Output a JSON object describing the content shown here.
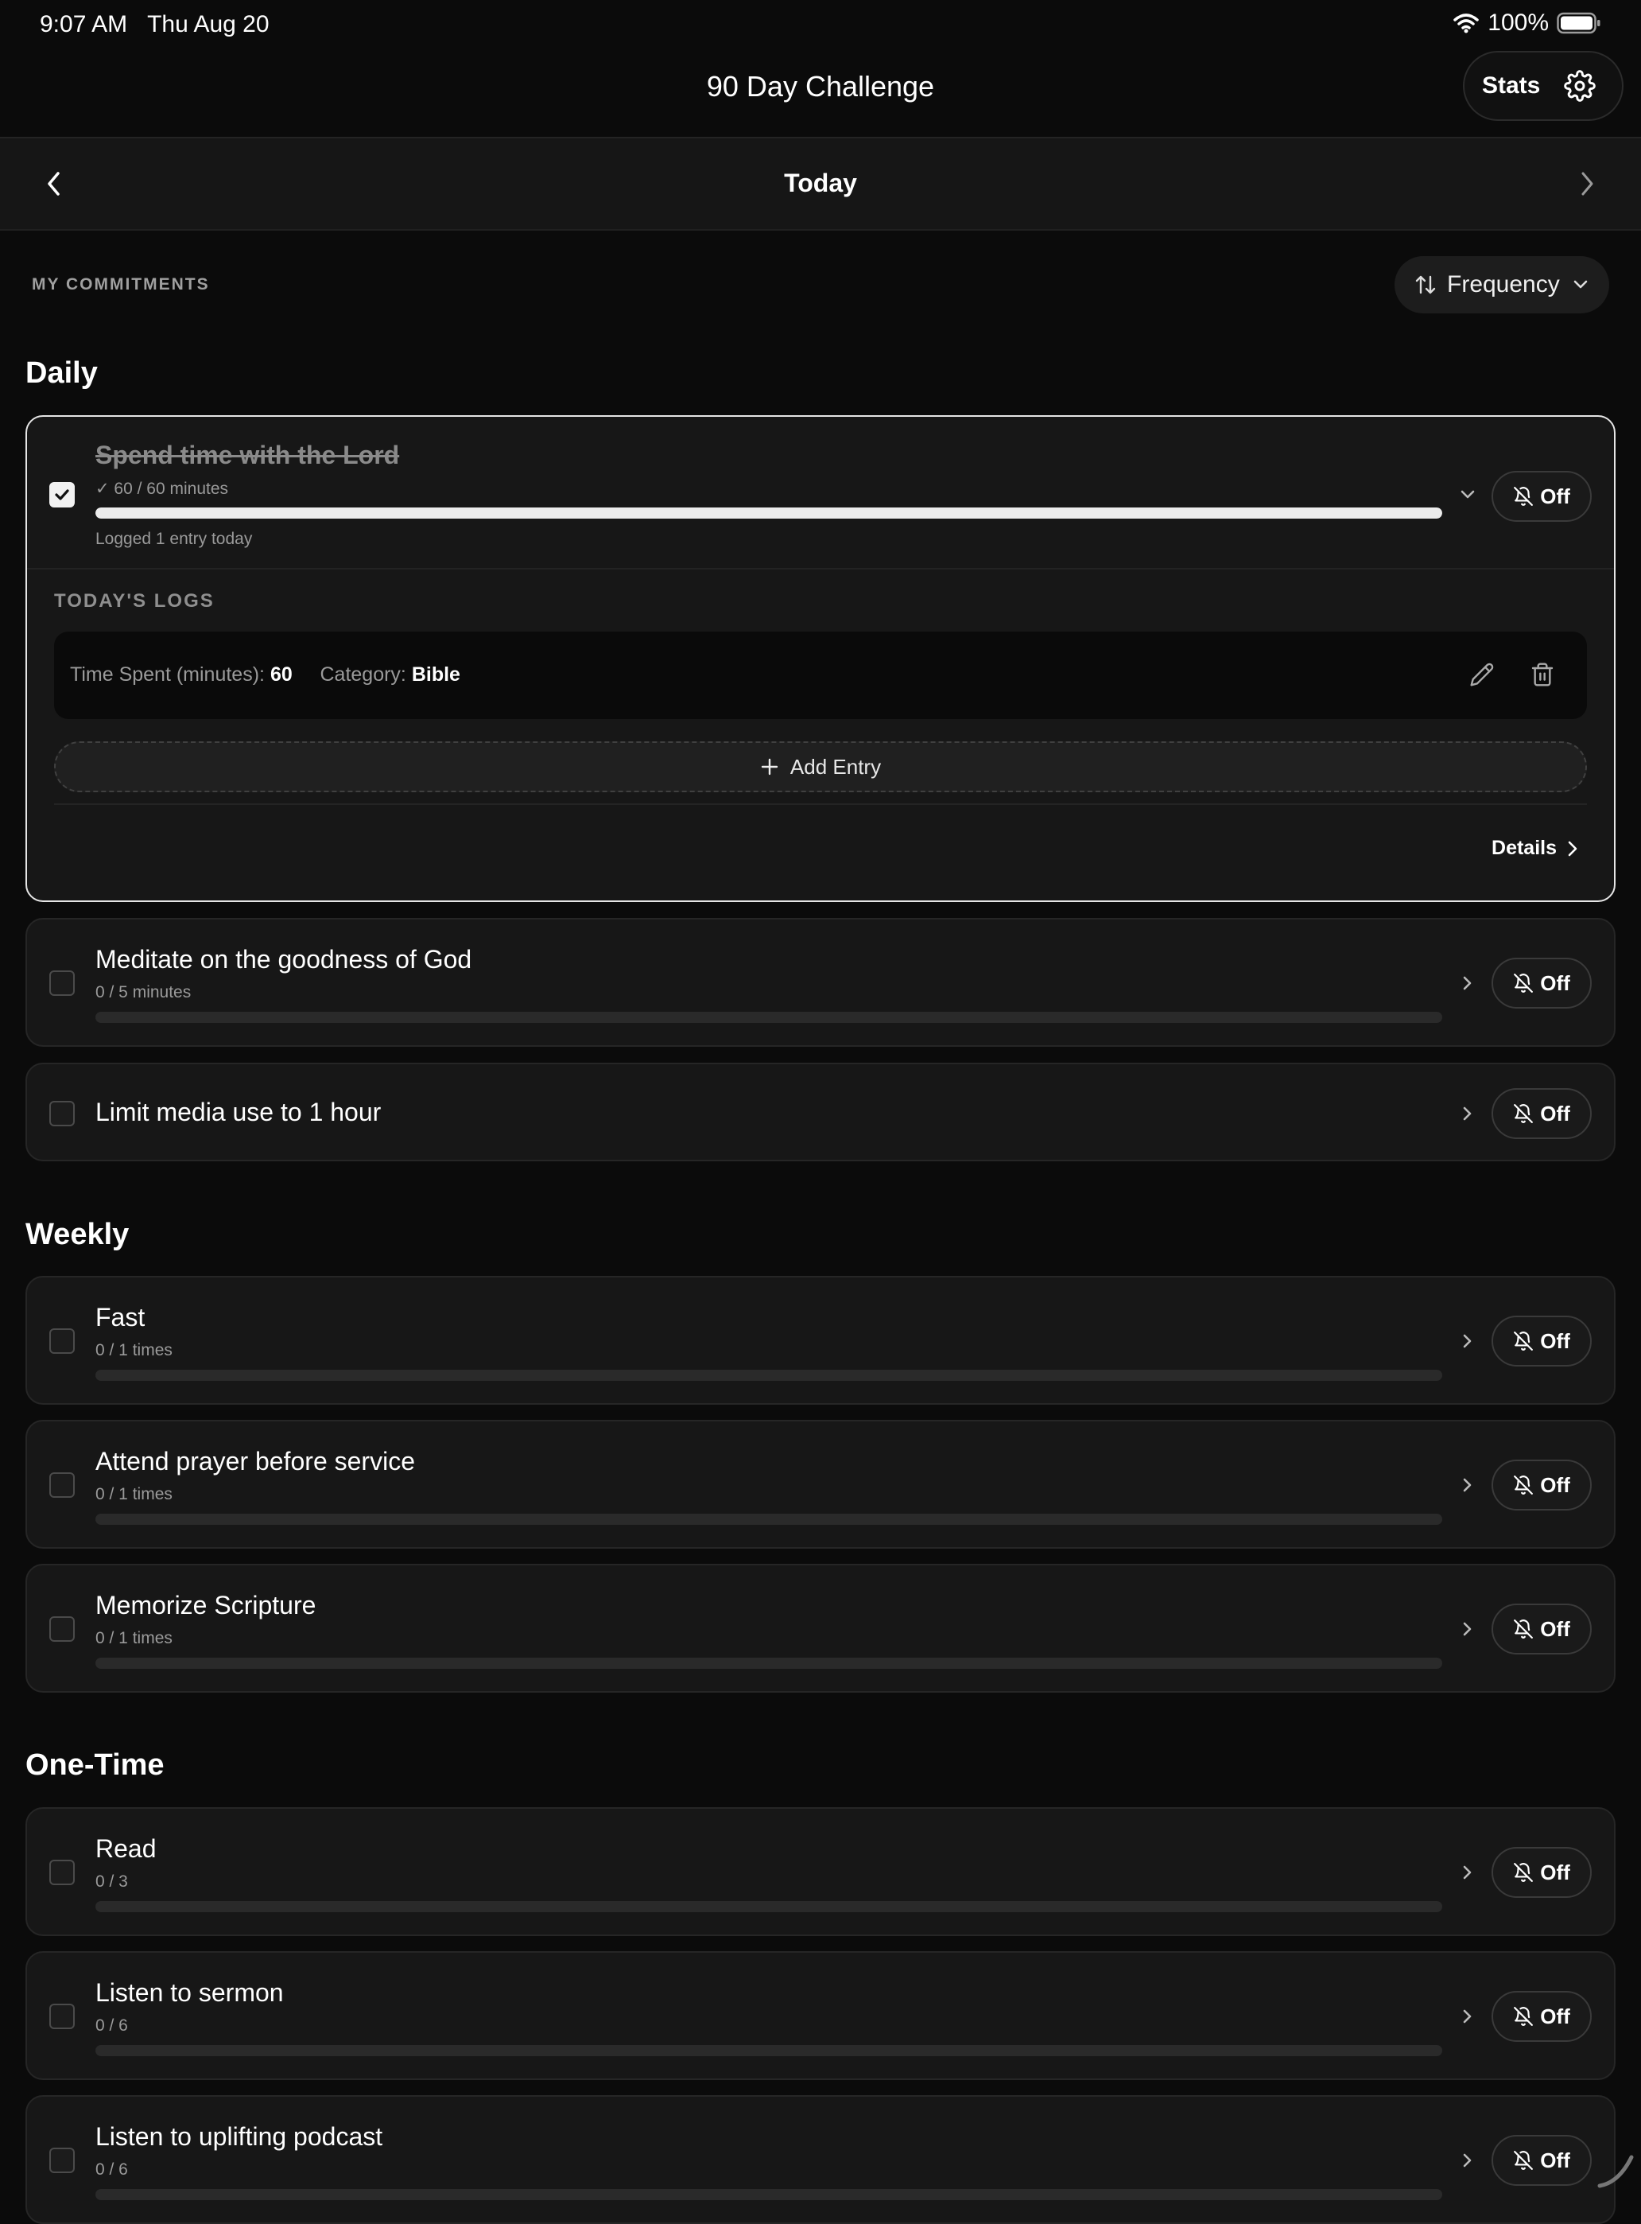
{
  "status_bar": {
    "time": "9:07 AM",
    "date": "Thu Aug 20",
    "battery": "100%"
  },
  "header": {
    "title": "90 Day Challenge",
    "stats_label": "Stats"
  },
  "date_nav": {
    "label": "Today"
  },
  "commitments": {
    "section_label": "MY COMMITMENTS",
    "sort_label": "Frequency"
  },
  "groups": {
    "daily": {
      "title": "Daily",
      "items": [
        {
          "title": "Spend time with the Lord",
          "progress_text": "✓ 60 / 60 minutes",
          "progress": 1.0,
          "logged_text": "Logged 1 entry today",
          "reminder": "Off",
          "checked": true,
          "logs_label": "TODAY'S LOGS",
          "log": {
            "time_label": "Time Spent (minutes):",
            "time_value": "60",
            "category_label": "Category:",
            "category_value": "Bible"
          },
          "add_entry_label": "Add Entry",
          "details_label": "Details"
        },
        {
          "title": "Meditate on the goodness of God",
          "progress_text": "0 / 5 minutes",
          "progress": 0,
          "reminder": "Off"
        },
        {
          "title": "Limit media use to 1 hour",
          "reminder": "Off"
        }
      ]
    },
    "weekly": {
      "title": "Weekly",
      "items": [
        {
          "title": "Fast",
          "progress_text": "0 / 1 times",
          "progress": 0,
          "reminder": "Off"
        },
        {
          "title": "Attend prayer before service",
          "progress_text": "0 / 1 times",
          "progress": 0,
          "reminder": "Off"
        },
        {
          "title": "Memorize Scripture",
          "progress_text": "0 / 1 times",
          "progress": 0,
          "reminder": "Off"
        }
      ]
    },
    "one_time": {
      "title": "One-Time",
      "items": [
        {
          "title": "Read",
          "progress_text": "0 / 3",
          "progress": 0,
          "reminder": "Off"
        },
        {
          "title": "Listen to sermon",
          "progress_text": "0 / 6",
          "progress": 0,
          "reminder": "Off"
        },
        {
          "title": "Listen to uplifting podcast",
          "progress_text": "0 / 6",
          "progress": 0,
          "reminder": "Off"
        }
      ]
    }
  },
  "icons": {
    "wifi": "wifi-icon",
    "battery": "battery-icon",
    "settings": "gear-icon",
    "back": "chevron-left-icon",
    "forward": "chevron-right-icon",
    "sort": "sort-arrows-icon",
    "dropdown": "chevron-down-icon",
    "bell_off": "bell-off-icon",
    "edit": "pencil-icon",
    "delete": "trash-icon",
    "add": "plus-icon",
    "check": "checkmark-icon"
  }
}
